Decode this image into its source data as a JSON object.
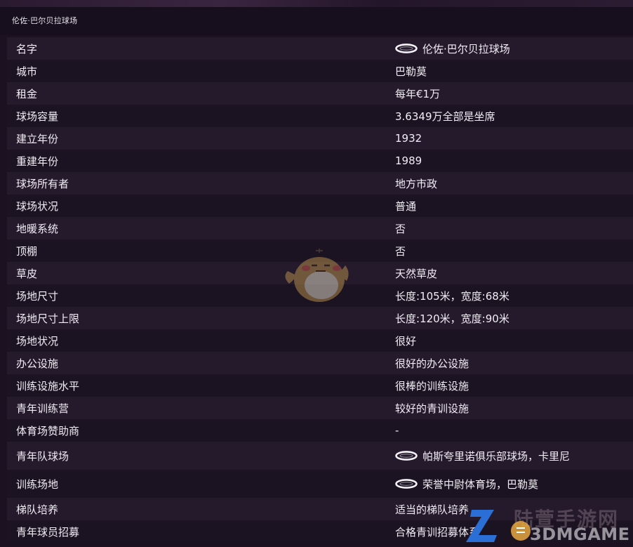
{
  "header": {
    "title": "伦佐·巴尔贝拉球场"
  },
  "rows": [
    {
      "label": "名字",
      "value": "伦佐·巴尔贝拉球场",
      "icon": "ring-icon"
    },
    {
      "label": "城市",
      "value": "巴勒莫"
    },
    {
      "label": "租金",
      "value": "每年€1万"
    },
    {
      "label": "球场容量",
      "value": "3.6349万全部是坐席"
    },
    {
      "label": "建立年份",
      "value": "1932"
    },
    {
      "label": "重建年份",
      "value": "1989"
    },
    {
      "label": "球场所有者",
      "value": "地方市政"
    },
    {
      "label": "球场状况",
      "value": "普通"
    },
    {
      "label": "地暖系统",
      "value": "否"
    },
    {
      "label": "顶棚",
      "value": "否"
    },
    {
      "label": "草皮",
      "value": "天然草皮"
    },
    {
      "label": "场地尺寸",
      "value": "长度:105米，宽度:68米"
    },
    {
      "label": "场地尺寸上限",
      "value": "长度:120米，宽度:90米"
    },
    {
      "label": "场地状况",
      "value": "很好"
    },
    {
      "label": "办公设施",
      "value": "很好的办公设施"
    },
    {
      "label": "训练设施水平",
      "value": "很棒的训练设施"
    },
    {
      "label": "青年训练营",
      "value": "较好的青训设施"
    },
    {
      "label": "体育场赞助商",
      "value": "-"
    },
    {
      "label": "青年队球场",
      "value": "帕斯夸里诺俱乐部球场，卡里尼",
      "icon": "ring-icon"
    },
    {
      "label": "训练场地",
      "value": "荣誉中尉体育场，巴勒莫",
      "icon": "ring-icon"
    },
    {
      "label": "梯队培养",
      "value": "适当的梯队培养"
    },
    {
      "label": "青年球员招募",
      "value": "合格青训招募体系"
    }
  ],
  "watermark": {
    "brand": "3DMGAME"
  },
  "colors": {
    "background": "#1b1121",
    "header": "#170f1d",
    "row_odd": "#251a2c",
    "row_even": "#1c1322",
    "text": "#f1edf4"
  }
}
